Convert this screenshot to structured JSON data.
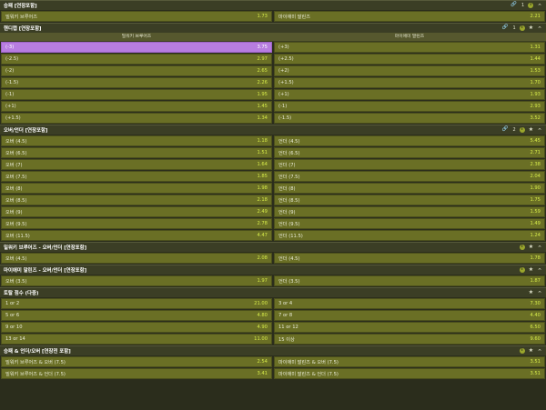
{
  "markets": [
    {
      "title": "승패 [연장포함]",
      "link_count": "1",
      "has_link": true,
      "has_info": true,
      "has_star": false,
      "collapsible": true,
      "headers": [],
      "rows": [
        [
          {
            "label": "밀워키 브루어즈",
            "odd": "1.73"
          },
          {
            "label": "마이애미 말린즈",
            "odd": "2.21"
          }
        ]
      ]
    },
    {
      "title": "핸디캡 [연장포함]",
      "link_count": "1",
      "has_link": true,
      "has_info": true,
      "has_star": true,
      "collapsible": true,
      "headers": [
        "밀워키 브루어즈",
        "마이애미 말린즈"
      ],
      "rows": [
        [
          {
            "label": "(-3)",
            "odd": "3.75",
            "selected": true
          },
          {
            "label": "(+3)",
            "odd": "1.31"
          }
        ],
        [
          {
            "label": "(-2.5)",
            "odd": "2.97"
          },
          {
            "label": "(+2.5)",
            "odd": "1.44"
          }
        ],
        [
          {
            "label": "(-2)",
            "odd": "2.65"
          },
          {
            "label": "(+2)",
            "odd": "1.53"
          }
        ],
        [
          {
            "label": "(-1.5)",
            "odd": "2.26"
          },
          {
            "label": "(+1.5)",
            "odd": "1.70"
          }
        ],
        [
          {
            "label": "(-1)",
            "odd": "1.95"
          },
          {
            "label": "(+1)",
            "odd": "1.93"
          }
        ],
        [
          {
            "label": "(+1)",
            "odd": "1.45"
          },
          {
            "label": "(-1)",
            "odd": "2.93"
          }
        ],
        [
          {
            "label": "(+1.5)",
            "odd": "1.34"
          },
          {
            "label": "(-1.5)",
            "odd": "3.52"
          }
        ]
      ]
    },
    {
      "title": "오버/언더 [연장포함]",
      "link_count": "2",
      "has_link": true,
      "has_info": true,
      "has_star": true,
      "collapsible": true,
      "headers": [],
      "rows": [
        [
          {
            "label": "오버 (4.5)",
            "odd": "1.18"
          },
          {
            "label": "언더 (4.5)",
            "odd": "5.45"
          }
        ],
        [
          {
            "label": "오버 (6.5)",
            "odd": "1.51"
          },
          {
            "label": "언더 (6.5)",
            "odd": "2.71"
          }
        ],
        [
          {
            "label": "오버 (7)",
            "odd": "1.64"
          },
          {
            "label": "언더 (7)",
            "odd": "2.38"
          }
        ],
        [
          {
            "label": "오버 (7.5)",
            "odd": "1.85"
          },
          {
            "label": "언더 (7.5)",
            "odd": "2.04"
          }
        ],
        [
          {
            "label": "오버 (8)",
            "odd": "1.98"
          },
          {
            "label": "언더 (8)",
            "odd": "1.90"
          }
        ],
        [
          {
            "label": "오버 (8.5)",
            "odd": "2.18"
          },
          {
            "label": "언더 (8.5)",
            "odd": "1.75"
          }
        ],
        [
          {
            "label": "오버 (9)",
            "odd": "2.49"
          },
          {
            "label": "언더 (9)",
            "odd": "1.59"
          }
        ],
        [
          {
            "label": "오버 (9.5)",
            "odd": "2.78"
          },
          {
            "label": "언더 (9.5)",
            "odd": "1.49"
          }
        ],
        [
          {
            "label": "오버 (11.5)",
            "odd": "4.47"
          },
          {
            "label": "언더 (11.5)",
            "odd": "1.24"
          }
        ]
      ]
    },
    {
      "title": "밀워키 브루어즈 - 오버/언더 [연장포함]",
      "link_count": "",
      "has_link": false,
      "has_info": true,
      "has_star": true,
      "collapsible": true,
      "headers": [],
      "rows": [
        [
          {
            "label": "오버 (4.5)",
            "odd": "2.08"
          },
          {
            "label": "언더 (4.5)",
            "odd": "1.78"
          }
        ]
      ]
    },
    {
      "title": "마이애미 말린즈 - 오버/언더 [연장포함]",
      "link_count": "",
      "has_link": false,
      "has_info": true,
      "has_star": true,
      "collapsible": true,
      "headers": [],
      "rows": [
        [
          {
            "label": "오버 (3.5)",
            "odd": "1.97"
          },
          {
            "label": "언더 (3.5)",
            "odd": "1.87"
          }
        ]
      ]
    },
    {
      "title": "토탈 점수 (다중)",
      "link_count": "",
      "has_link": false,
      "has_info": false,
      "has_star": true,
      "collapsible": true,
      "headers": [],
      "rows": [
        [
          {
            "label": "1 or 2",
            "odd": "21.00"
          },
          {
            "label": "3 or 4",
            "odd": "7.30"
          }
        ],
        [
          {
            "label": "5 or 6",
            "odd": "4.80"
          },
          {
            "label": "7 or 8",
            "odd": "4.40"
          }
        ],
        [
          {
            "label": "9 or 10",
            "odd": "4.90"
          },
          {
            "label": "11 or 12",
            "odd": "6.50"
          }
        ],
        [
          {
            "label": "13 or 14",
            "odd": "11.00"
          },
          {
            "label": "15 이상",
            "odd": "9.60"
          }
        ]
      ]
    },
    {
      "title": "승패 & 언더/오버 [연장전 포함]",
      "link_count": "",
      "has_link": false,
      "has_info": true,
      "has_star": true,
      "collapsible": true,
      "headers": [],
      "rows": [
        [
          {
            "label": "밀워키 브루어즈 & 오버 (7.5)",
            "odd": "2.54"
          },
          {
            "label": "마이애미 말린즈 & 오버 (7.5)",
            "odd": "3.51"
          }
        ],
        [
          {
            "label": "밀워키 브루어즈 & 언더 (7.5)",
            "odd": "3.41"
          },
          {
            "label": "마이애미 말린즈 & 언더 (7.5)",
            "odd": "3.51"
          }
        ]
      ]
    }
  ],
  "icons": {
    "link": "link-icon",
    "info": "info-icon",
    "star": "star-icon",
    "collapse": "chevron-up-icon"
  },
  "colors": {
    "background": "#2b2d1c",
    "header": "#3b3e25",
    "cell": "#6a6f25",
    "odd": "#d7ec4a",
    "selected": "#b77de0"
  }
}
